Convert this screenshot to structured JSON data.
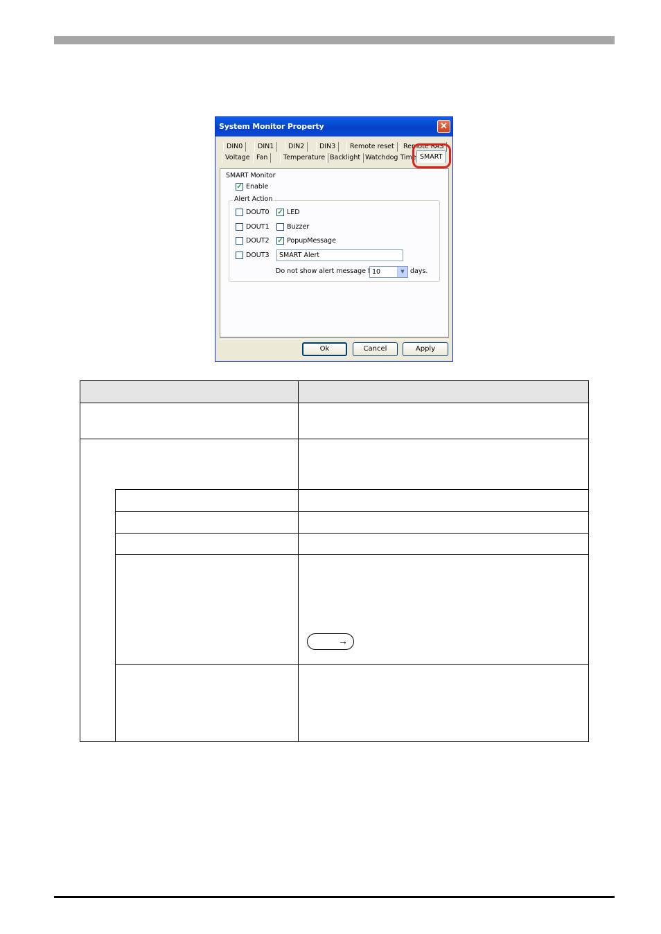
{
  "dialog": {
    "title": "System Monitor Property",
    "close_glyph": "✕",
    "tabs_row1": [
      "DIN0",
      "DIN1",
      "DIN2",
      "DIN3",
      "Remote reset",
      "Remote RAS"
    ],
    "tabs_row2": [
      "Voltage",
      "Fan",
      "Temperature",
      "Backlight",
      "Watchdog Timer"
    ],
    "active_tab": "SMART",
    "smart_monitor_label": "SMART Monitor",
    "enable_label": "Enable",
    "enable_checked": true,
    "alert_action_label": "Alert Action",
    "douts": [
      {
        "label": "DOUT0",
        "checked": false
      },
      {
        "label": "DOUT1",
        "checked": false
      },
      {
        "label": "DOUT2",
        "checked": false
      },
      {
        "label": "DOUT3",
        "checked": false
      }
    ],
    "led": {
      "label": "LED",
      "checked": true
    },
    "buzzer": {
      "label": "Buzzer",
      "checked": false
    },
    "popup": {
      "label": "PopupMessage",
      "checked": true
    },
    "popup_text": "SMART Alert",
    "days_prefix": "Do not show alert message for",
    "days_value": "10",
    "days_suffix": "days.",
    "ok_label": "Ok",
    "cancel_label": "Cancel",
    "apply_label": "Apply"
  },
  "icons": {
    "check": "check-mark",
    "combo_arrow": "chevron-down-icon",
    "arrow": "right-arrow-icon"
  },
  "arrow_glyph": "→",
  "check_glyph": "✓",
  "combo_glyph": "▼"
}
